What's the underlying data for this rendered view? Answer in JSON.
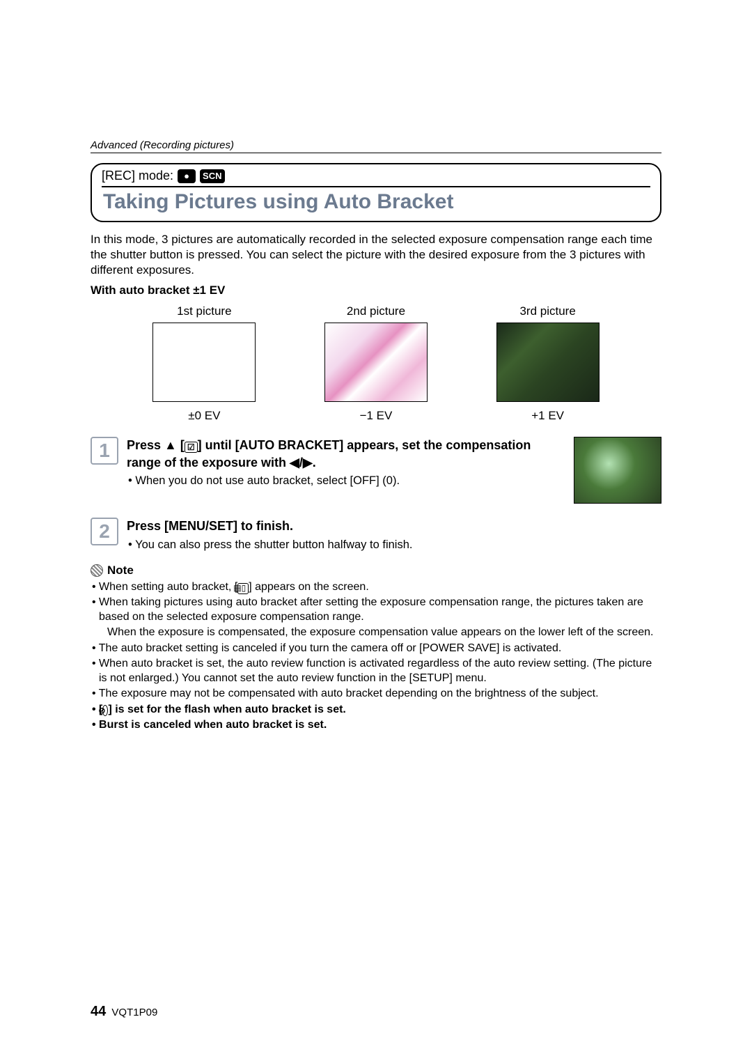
{
  "header": {
    "section": "Advanced (Recording pictures)"
  },
  "title_block": {
    "rec_mode_label": "[REC] mode:",
    "mode_icons": [
      "●",
      "SCN"
    ],
    "title": "Taking Pictures using Auto Bracket"
  },
  "intro": "In this mode, 3 pictures are automatically recorded in the selected exposure compensation range each time the shutter button is pressed. You can select the picture with the desired exposure from the 3 pictures with different exposures.",
  "subhead": "With auto bracket ±1 EV",
  "samples": [
    {
      "label": "1st picture",
      "ev": "±0 EV"
    },
    {
      "label": "2nd picture",
      "ev": "−1 EV"
    },
    {
      "label": "3rd picture",
      "ev": "+1 EV"
    }
  ],
  "steps": [
    {
      "num": "1",
      "title_pre": "Press ▲ [",
      "title_mid": "] until [AUTO BRACKET] appears, set the compensation range of the exposure with ◀/▶.",
      "bullet": "When you do not use auto bracket, select [OFF] (0)."
    },
    {
      "num": "2",
      "title": "Press [MENU/SET] to finish.",
      "bullet": "You can also press the shutter button halfway to finish."
    }
  ],
  "note_label": "Note",
  "notes": [
    {
      "pre": "When setting auto bracket, [",
      "post": "] appears on the screen."
    },
    {
      "text": "When taking pictures using auto bracket after setting the exposure compensation range, the pictures taken are based on the selected exposure compensation range."
    },
    {
      "sub": true,
      "text": "When the exposure is compensated, the exposure compensation value appears on the lower left of the screen."
    },
    {
      "text": "The auto bracket setting is canceled if you turn the camera off or [POWER SAVE] is activated."
    },
    {
      "text": "When auto bracket is set, the auto review function is activated regardless of the auto review setting. (The picture is not enlarged.) You cannot set the auto review function in the [SETUP] menu."
    },
    {
      "text": "The exposure may not be compensated with auto bracket depending on the brightness of the subject."
    },
    {
      "bold": true,
      "pre": "[",
      "post": "] is set for the flash when auto bracket is set."
    },
    {
      "bold": true,
      "text": "Burst is canceled when auto bracket is set."
    }
  ],
  "icons": {
    "exposure_comp": "☑",
    "auto_bracket": "▤▯",
    "flash_off": "⊘"
  },
  "footer": {
    "page": "44",
    "doc": "VQT1P09"
  }
}
